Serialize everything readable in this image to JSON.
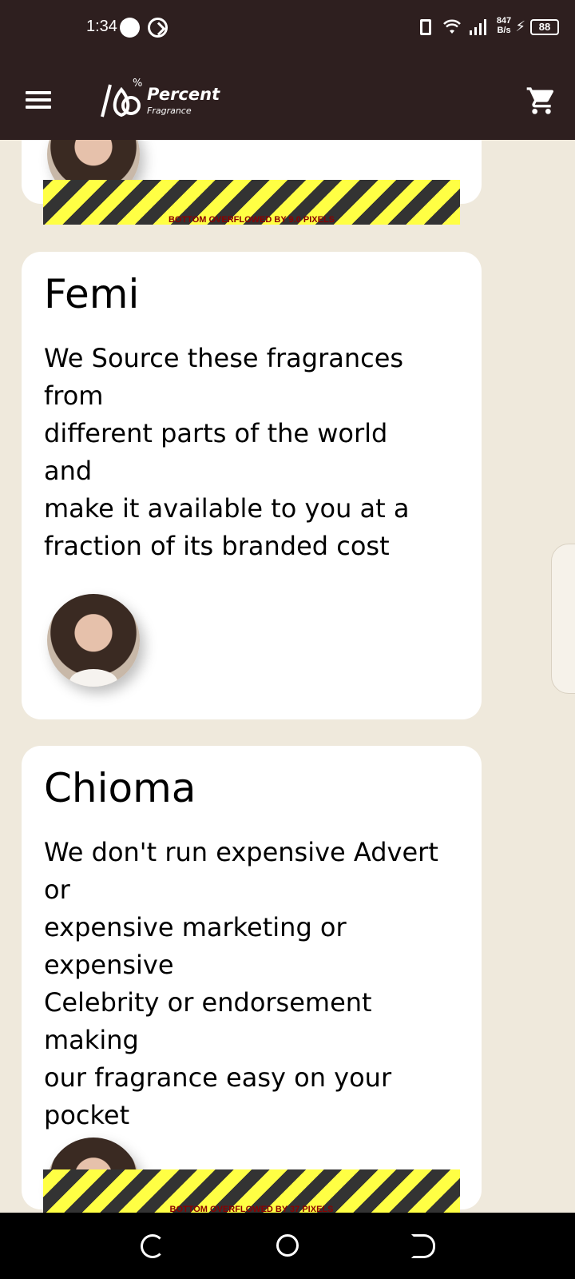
{
  "status_bar": {
    "time": "1:34",
    "net_speed_value": "847",
    "net_speed_unit": "B/s",
    "battery": "88"
  },
  "app_bar": {
    "logo_mark": "100%",
    "brand_name": "Percent",
    "brand_sub": "Fragrance"
  },
  "cards": [
    {
      "name": "",
      "text": "",
      "overflow_label": "BOTTOM OVERFLOWED BY 9.0 PIXELS"
    },
    {
      "name": "Femi",
      "text": "We Source these fragrances\nfrom\ndifferent parts of the world\nand\nmake it available to you at a\nfraction of its branded cost",
      "overflow_label": ""
    },
    {
      "name": "Chioma",
      "text": "We don't run expensive Advert\nor\nexpensive marketing or\nexpensive\nCelebrity or endorsement\nmaking\nour fragrance easy on your\npocket",
      "overflow_label": "BOTTOM OVERFLOWED BY 37 PIXELS"
    }
  ]
}
